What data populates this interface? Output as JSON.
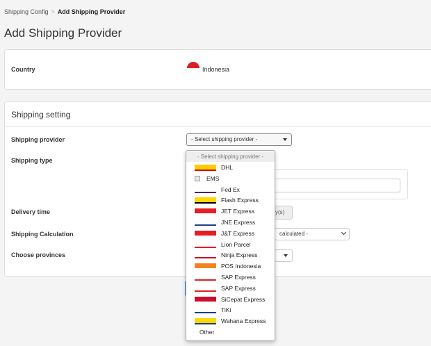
{
  "breadcrumb": {
    "parent": "Shipping Config",
    "separator": ">",
    "current": "Add Shipping Provider"
  },
  "page_title": "Add Shipping Provider",
  "country": {
    "label": "Country",
    "value": "Indonesia"
  },
  "shipping_setting": {
    "title": "Shipping setting",
    "provider_label": "Shipping provider",
    "provider_select_value": "- Select shipping provider -",
    "type_label": "Shipping type",
    "delivery_label": "Delivery time",
    "delivery_suffix": "y(s)",
    "calculation_label": "Shipping Calculation",
    "calculation_value": "calculated -",
    "provinces_label": "Choose provinces"
  },
  "dropdown": {
    "placeholder": "- Select shipping provider -",
    "items": [
      {
        "name": "DHL",
        "logo": "dhl-logo",
        "bg": "#ffcc00",
        "fg": "#d40511"
      },
      {
        "name": "EMS",
        "logo": "broken-image-icon",
        "broken": true
      },
      {
        "name": "Fed Ex",
        "logo": "fedex-logo",
        "bg": "#ffffff",
        "fg": "#4d148c"
      },
      {
        "name": "Flash Express",
        "logo": "flash-express-logo",
        "bg": "#ffd600",
        "fg": "#000000"
      },
      {
        "name": "JET Express",
        "logo": "jet-express-logo",
        "bg": "#e31e24",
        "fg": "#ffffff"
      },
      {
        "name": "JNE Express",
        "logo": "jne-logo",
        "bg": "#ffffff",
        "fg": "#1b3c8c"
      },
      {
        "name": "J&T Express",
        "logo": "jnt-logo",
        "bg": "#e31e24",
        "fg": "#ffffff"
      },
      {
        "name": "Lion Parcel",
        "logo": "lion-parcel-logo",
        "bg": "#ffffff",
        "fg": "#e31e24"
      },
      {
        "name": "Ninja Express",
        "logo": "ninja-express-logo",
        "bg": "#ffffff",
        "fg": "#c8102e"
      },
      {
        "name": "POS Indonesia",
        "logo": "pos-indonesia-logo",
        "bg": "#f58220",
        "fg": "#ffffff"
      },
      {
        "name": "SAP Express",
        "logo": "sap-express-logo",
        "bg": "#ffffff",
        "fg": "#e31e24"
      },
      {
        "name": "SAP Express",
        "logo": "sap-express-logo",
        "bg": "#ffffff",
        "fg": "#e31e24"
      },
      {
        "name": "SiCepat Express",
        "logo": "sicepat-logo",
        "bg": "#c8102e",
        "fg": "#ffffff"
      },
      {
        "name": "TiKi",
        "logo": "tiki-logo",
        "bg": "#ffffff",
        "fg": "#1b3c8c"
      },
      {
        "name": "Wahana Express",
        "logo": "wahana-logo",
        "bg": "#ffd600",
        "fg": "#1b3c8c"
      },
      {
        "name": "Other",
        "logo": "",
        "other": true
      }
    ]
  },
  "colors": {
    "accent": "#2aa3dd",
    "flag_red": "#d91f26"
  }
}
